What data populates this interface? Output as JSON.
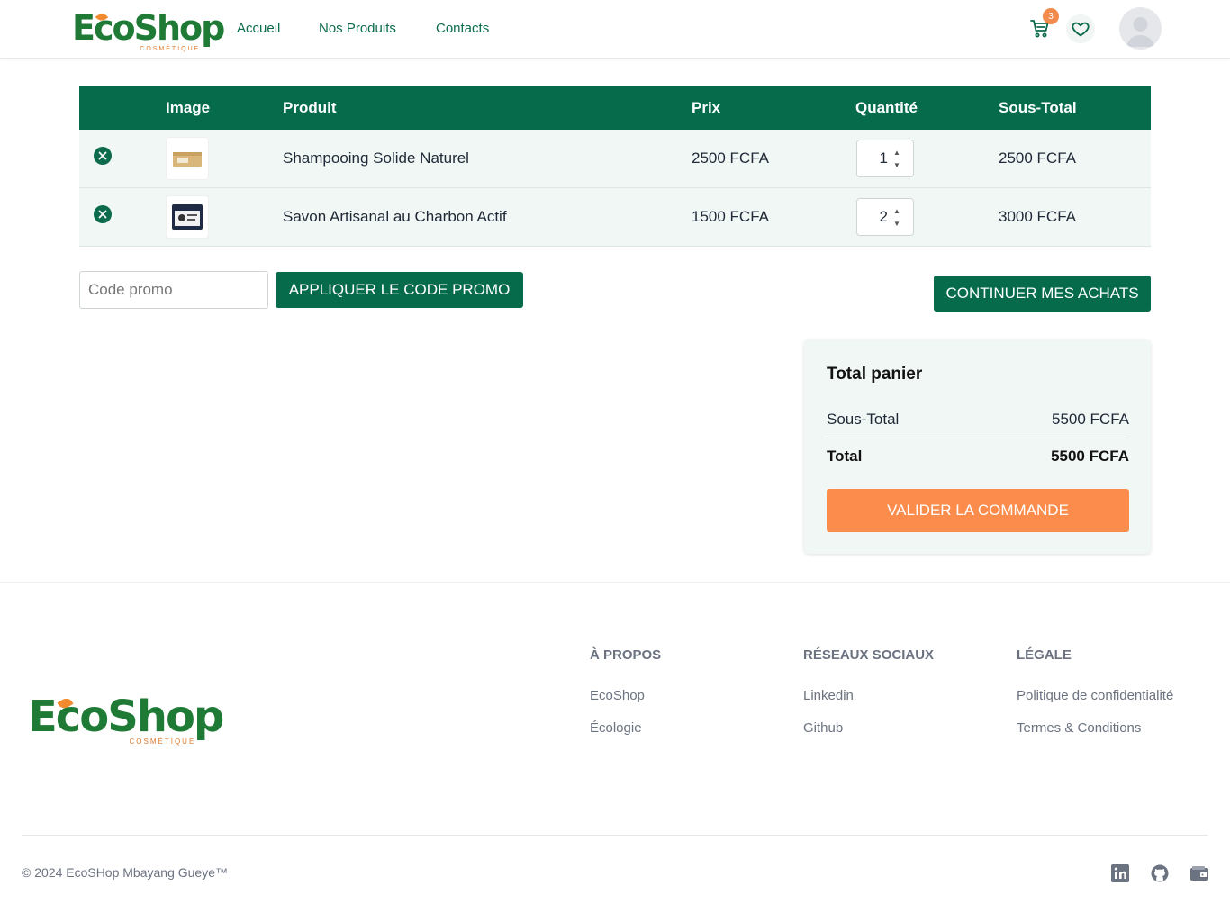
{
  "brand": {
    "name": "EcoShop",
    "tagline": "COSMÉTIQUE"
  },
  "nav": {
    "links": [
      "Accueil",
      "Nos Produits",
      "Contacts"
    ],
    "cart_count": "3"
  },
  "table": {
    "headers": {
      "image": "Image",
      "product": "Produit",
      "price": "Prix",
      "quantity": "Quantité",
      "subtotal": "Sous-Total"
    },
    "rows": [
      {
        "product": "Shampooing Solide Naturel",
        "price": "2500 FCFA",
        "quantity": "1",
        "subtotal": "2500 FCFA"
      },
      {
        "product": "Savon Artisanal au Charbon Actif",
        "price": "1500 FCFA",
        "quantity": "2",
        "subtotal": "3000 FCFA"
      }
    ]
  },
  "promo": {
    "placeholder": "Code promo",
    "apply_label": "APPLIQUER LE CODE PROMO"
  },
  "continue_label": "CONTINUER MES ACHATS",
  "totals": {
    "title": "Total panier",
    "subtotal_label": "Sous-Total",
    "subtotal_value": "5500 FCFA",
    "total_label": "Total",
    "total_value": "5500 FCFA",
    "validate_label": "VALIDER LA COMMANDE"
  },
  "footer": {
    "columns": [
      {
        "title": "À PROPOS",
        "links": [
          "EcoShop",
          "Écologie"
        ]
      },
      {
        "title": "RÉSEAUX SOCIAUX",
        "links": [
          "Linkedin",
          "Github"
        ]
      },
      {
        "title": "LÉGALE",
        "links": [
          "Politique de confidentialité",
          "Termes & Conditions"
        ]
      }
    ],
    "copyright": "© 2024 EcoSHop Mbayang Gueye™",
    "social_icons": [
      "linkedin-icon",
      "github-icon",
      "wallet-icon"
    ]
  },
  "colors": {
    "primary": "#066b4b",
    "accent": "#fb8c4b",
    "row_bg": "#f1f7f4"
  }
}
